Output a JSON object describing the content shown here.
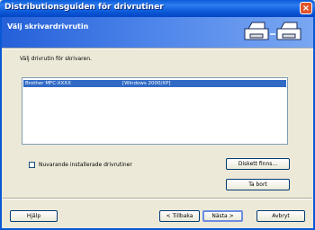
{
  "window": {
    "title": "Distributionsguiden för drivrutiner"
  },
  "header": {
    "title": "Välj skrivardrivrutin"
  },
  "main": {
    "instruction": "Välj drivrutin för skrivaren.",
    "list": {
      "rows": [
        {
          "name": "Brother  MFC-XXXX",
          "os": "[Windows 2000/XP]",
          "selected": true
        }
      ]
    },
    "checkbox_label": "Nuvarande installerade drivrutiner",
    "buttons": {
      "disk": "Diskett finns...",
      "remove": "Ta bort"
    }
  },
  "footer": {
    "help": "Hjälp",
    "back": "< Tillbaka",
    "next": "Nästa >",
    "cancel": "Avbryt"
  },
  "colors": {
    "selection": "#316ac5",
    "title_bar": "#0b58d6"
  }
}
